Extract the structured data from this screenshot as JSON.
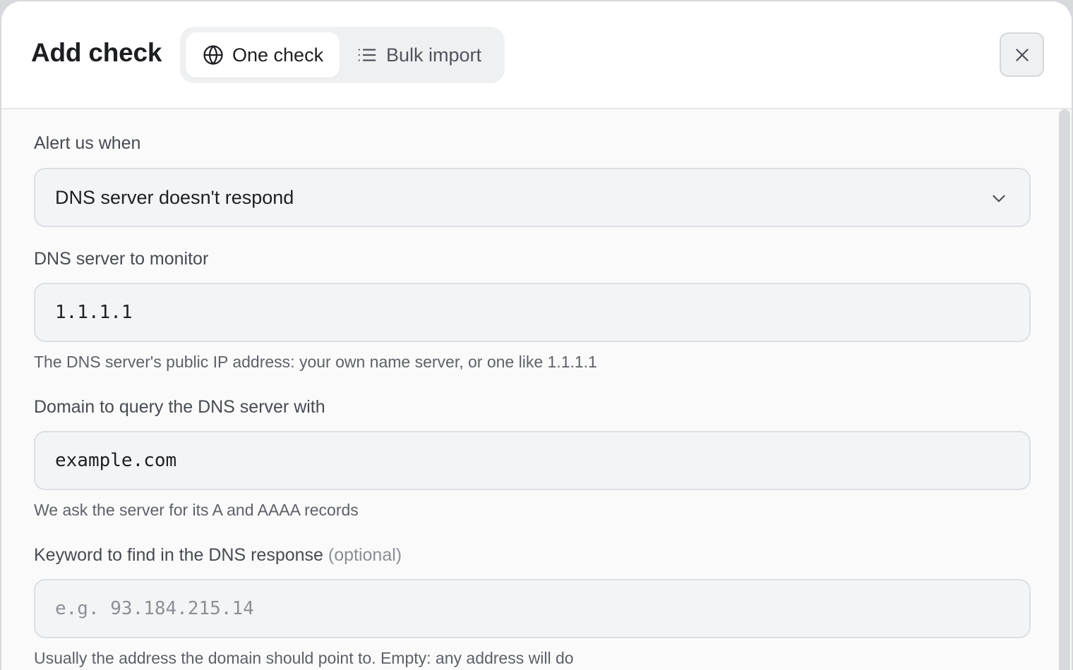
{
  "dialog": {
    "title": "Add check",
    "tabs": [
      {
        "label": "One check",
        "icon": "globe-icon",
        "active": true
      },
      {
        "label": "Bulk import",
        "icon": "list-icon",
        "active": false
      }
    ],
    "close_icon": "close-icon"
  },
  "form": {
    "alert": {
      "label": "Alert us when",
      "value": "DNS server doesn't respond",
      "icon": "chevron-down-icon"
    },
    "dns_server": {
      "label": "DNS server to monitor",
      "value": "1.1.1.1",
      "help": "The DNS server's public IP address: your own name server, or one like 1.1.1.1"
    },
    "domain": {
      "label": "Domain to query the DNS server with",
      "value": "example.com",
      "help": "We ask the server for its A and AAAA records"
    },
    "keyword": {
      "label": "Keyword to find in the DNS response",
      "optional": "(optional)",
      "placeholder": "e.g. 93.184.215.14",
      "help": "Usually the address the domain should point to. Empty: any address will do"
    }
  },
  "colors": {
    "accent_text": "#1d1f23",
    "muted_text": "#5d6168",
    "field_bg": "#f3f4f6",
    "field_border": "#dcdfe3"
  }
}
